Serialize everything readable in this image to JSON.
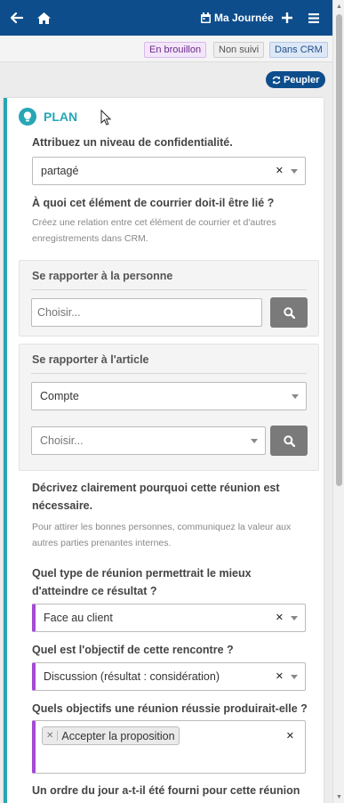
{
  "topbar": {
    "my_day_label": "Ma Journée"
  },
  "icons": {
    "back": "arrow-left-icon",
    "home": "home-icon",
    "calendar": "calendar-icon",
    "plus": "plus-icon",
    "menu": "hamburger-menu-icon",
    "refresh": "refresh-icon",
    "plan": "lightbulb-icon",
    "search": "search-icon"
  },
  "status_badges": {
    "draft": "En brouillon",
    "unfollowed": "Non suivi",
    "in_crm": "Dans CRM"
  },
  "populate_button": "Peupler",
  "plan": {
    "title": "PLAN",
    "confidentiality": {
      "label": "Attribuez un niveau de confidentialité.",
      "value": "partagé"
    },
    "relation": {
      "label": "À quoi cet élément de courrier doit-il être lié ?",
      "help": "Créez une relation entre cet élément de courrier et d'autres enregistrements dans CRM."
    },
    "person_panel": {
      "title": "Se rapporter à la personne",
      "placeholder": "Choisir..."
    },
    "article_panel": {
      "title": "Se rapporter à l'article",
      "type_value": "Compte",
      "placeholder": "Choisir..."
    },
    "reason": {
      "label": "Décrivez clairement pourquoi cette réunion est nécessaire.",
      "help": "Pour attirer les bonnes personnes, communiquez la valeur aux autres parties prenantes internes."
    },
    "meeting_type": {
      "label": "Quel type de réunion permettrait le mieux d'atteindre ce résultat ?",
      "value": "Face au client"
    },
    "objective": {
      "label": "Quel est l'objectif de cette rencontre ?",
      "value": "Discussion (résultat : considération)"
    },
    "goals": {
      "label": "Quels objectifs une réunion réussie produirait-elle ?",
      "chips": [
        "Accepter la proposition"
      ]
    },
    "agenda": {
      "label": "Un ordre du jour a-t-il été fourni pour cette réunion"
    }
  },
  "colors": {
    "header": "#0e4d8c",
    "plan_accent": "#27a6b5",
    "required_accent": "#a54ad4"
  }
}
